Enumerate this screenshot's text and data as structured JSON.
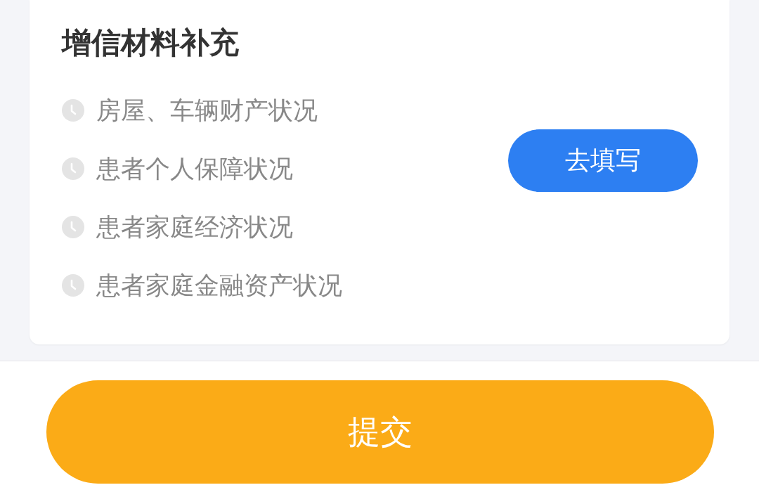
{
  "card": {
    "title": "增信材料补充",
    "items": [
      "房屋、车辆财产状况",
      "患者个人保障状况",
      "患者家庭经济状况",
      "患者家庭金融资产状况"
    ],
    "action_button": "去填写"
  },
  "submit_button": "提交"
}
